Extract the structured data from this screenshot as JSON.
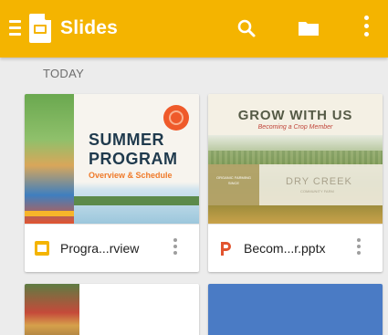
{
  "app": {
    "title": "Slides",
    "accent": "#F4B400"
  },
  "appbar": {
    "menu_icon": "menu-icon",
    "search_icon": "search-icon",
    "folder_icon": "folder-icon",
    "more_icon": "more-vert-icon"
  },
  "section": {
    "label": "TODAY"
  },
  "files": [
    {
      "name": "Progra...rview",
      "type_icon": "google-slides-icon",
      "type_color": "#F4B400",
      "thumbnail": {
        "line1": "SUMMER",
        "line2": "PROGRAM",
        "subtitle": "Overview & Schedule"
      }
    },
    {
      "name": "Becom...r.pptx",
      "type_icon": "powerpoint-icon",
      "type_color": "#E2542F",
      "thumbnail": {
        "title": "GROW WITH US",
        "subtitle": "Becoming a Crop Member",
        "box_text": "ORGANIC FARMING SINCE",
        "brand": "DRY CREEK",
        "brand_sub": "COMMUNITY FARM"
      }
    },
    {
      "type_icon": "",
      "thumbnail": {}
    },
    {
      "type_icon": "",
      "thumbnail": {}
    }
  ]
}
